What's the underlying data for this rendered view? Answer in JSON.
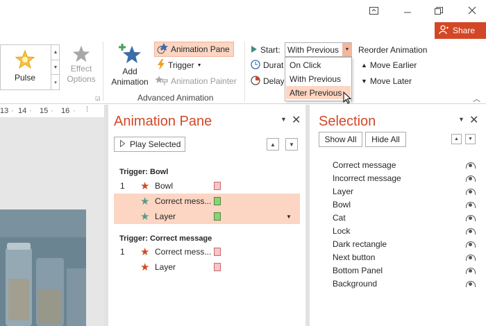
{
  "window": {
    "share_label": "Share"
  },
  "ribbon": {
    "gallery": {
      "selected_label": "Pulse"
    },
    "effect_options_label": "Effect Options",
    "add_animation_label": "Add Animation",
    "animation_pane_label": "Animation Pane",
    "trigger_label": "Trigger",
    "animation_painter_label": "Animation Painter",
    "advanced_animation_label": "Advanced Animation",
    "start_label": "Start:",
    "duration_label": "Duration",
    "delay_label": "Delay:",
    "start_value": "With Previous",
    "start_options": [
      "On Click",
      "With Previous",
      "After Previous"
    ],
    "reorder_label": "Reorder Animation",
    "move_earlier_label": "Move Earlier",
    "move_later_label": "Move Later"
  },
  "ruler": {
    "ticks": [
      "13",
      "14",
      "15",
      "16"
    ]
  },
  "animation_pane": {
    "title": "Animation Pane",
    "play_label": "Play Selected",
    "groups": [
      {
        "trigger": "Trigger: Bowl",
        "items": [
          {
            "index": "1",
            "name": "Bowl",
            "star_color": "#d24726",
            "bar_color": "#f4b4b4",
            "selected": false
          },
          {
            "index": "",
            "name": "Correct mess...",
            "star_color": "#4f9e8f",
            "bar_color": "#8fd07a",
            "selected": true
          },
          {
            "index": "",
            "name": "Layer",
            "star_color": "#4f9e8f",
            "bar_color": "#8fd07a",
            "selected": true
          }
        ]
      },
      {
        "trigger": "Trigger: Correct message",
        "items": [
          {
            "index": "1",
            "name": "Correct mess...",
            "star_color": "#d24726",
            "bar_color": "#f4b4b4",
            "selected": false
          },
          {
            "index": "",
            "name": "Layer",
            "star_color": "#d24726",
            "bar_color": "#f4b4b4",
            "selected": false
          }
        ]
      }
    ]
  },
  "selection_pane": {
    "title": "Selection",
    "show_all_label": "Show All",
    "hide_all_label": "Hide All",
    "items": [
      "Correct message",
      "Incorrect message",
      "Layer",
      "Bowl",
      "Cat",
      "Lock",
      "Dark rectangle",
      "Next button",
      "Bottom Panel",
      "Background"
    ]
  }
}
